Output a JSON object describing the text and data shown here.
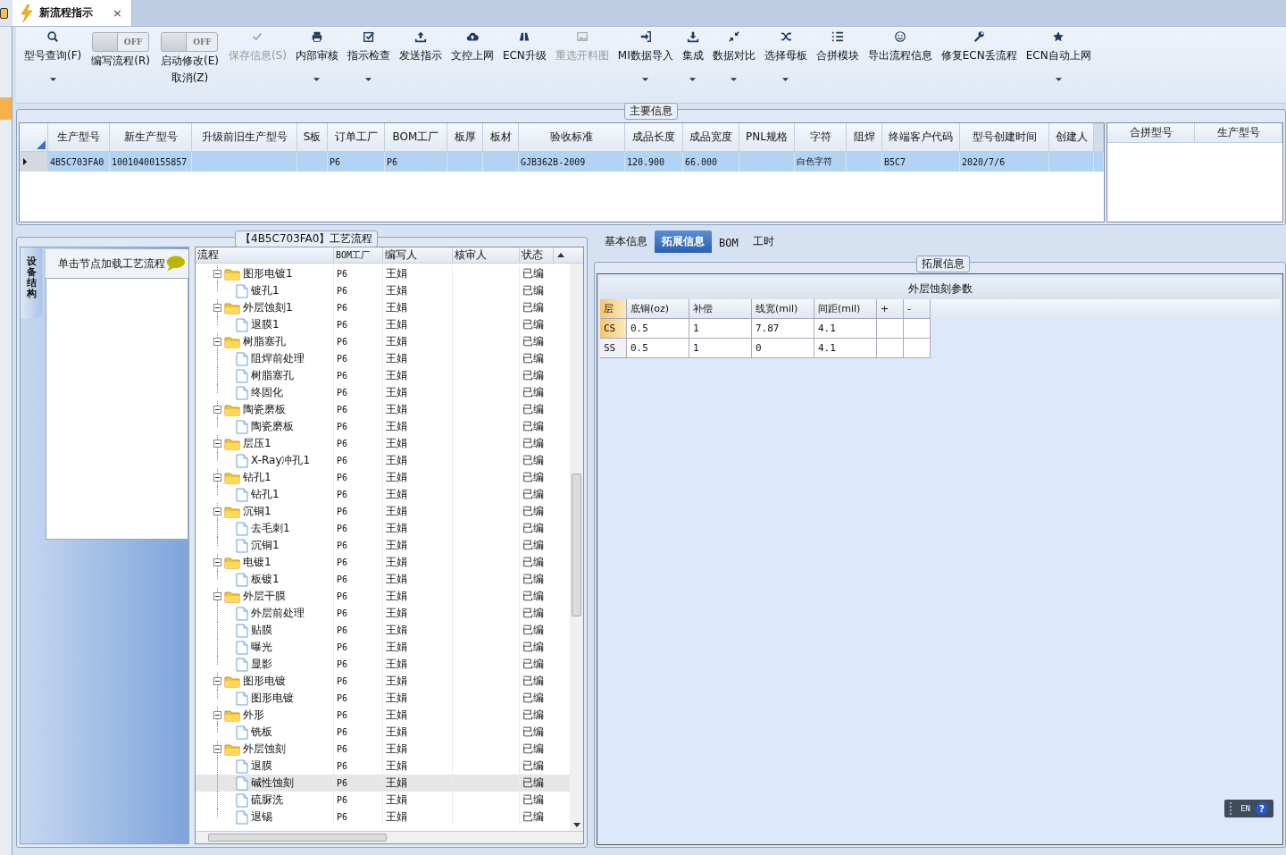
{
  "doc_tab": {
    "title": "新流程指示",
    "close": "×"
  },
  "toolbar": [
    {
      "kind": "button",
      "label": "型号查询(F)",
      "has_menu": true,
      "disabled": false
    },
    {
      "kind": "toggle",
      "toggle_text": "OFF",
      "on": false,
      "label": "编写流程(R)"
    },
    {
      "kind": "toggle",
      "toggle_text": "OFF",
      "on": false,
      "label": "启动修改(E)",
      "sub_label": "取消(Z)"
    },
    {
      "kind": "button",
      "label": "保存信息(S)",
      "has_menu": false,
      "disabled": true
    },
    {
      "kind": "button",
      "label": "内部审核",
      "has_menu": true,
      "disabled": false
    },
    {
      "kind": "button",
      "label": "指示检查",
      "has_menu": true,
      "disabled": false
    },
    {
      "kind": "button",
      "label": "发送指示",
      "has_menu": false,
      "disabled": false
    },
    {
      "kind": "button",
      "label": "文控上网",
      "has_menu": false,
      "disabled": false
    },
    {
      "kind": "button",
      "label": "ECN升级",
      "has_menu": false,
      "disabled": false
    },
    {
      "kind": "button",
      "label": "重选开料图",
      "has_menu": false,
      "disabled": true
    },
    {
      "kind": "button",
      "label": "MI数据导入",
      "has_menu": true,
      "disabled": false
    },
    {
      "kind": "button",
      "label": "集成",
      "has_menu": true,
      "disabled": false
    },
    {
      "kind": "button",
      "label": "数据对比",
      "has_menu": true,
      "disabled": false
    },
    {
      "kind": "button",
      "label": "选择母板",
      "has_menu": true,
      "disabled": false
    },
    {
      "kind": "button",
      "label": "合拼模块",
      "has_menu": false,
      "disabled": false
    },
    {
      "kind": "button",
      "label": "导出流程信息",
      "has_menu": false,
      "disabled": false
    },
    {
      "kind": "button",
      "label": "修复ECN丢流程",
      "has_menu": false,
      "disabled": false
    },
    {
      "kind": "button",
      "label": "ECN自动上网",
      "has_menu": true,
      "disabled": false
    }
  ],
  "main_info": {
    "title": "主要信息",
    "columns": [
      "生产型号",
      "新生产型号",
      "升级前旧生产型号",
      "S板",
      "订单工厂",
      "BOM工厂",
      "板厚",
      "板材",
      "验收标准",
      "成品长度",
      "成品宽度",
      "PNL规格",
      "字符",
      "阻焊",
      "终端客户代码",
      "型号创建时间",
      "创建人"
    ],
    "rows": [
      {
        "selected": true,
        "cells": [
          "4B5C703FA0",
          "10010400155857",
          "",
          "",
          "P6",
          "P6",
          "",
          "",
          "GJB362B-2009",
          "120.900",
          "66.000",
          "",
          "白色字符",
          "",
          "B5C7",
          "2020/7/6",
          ""
        ]
      }
    ],
    "side_columns": [
      "合拼型号",
      "生产型号"
    ]
  },
  "side_panel": {
    "vertical_tab": "设备结构",
    "hint": "单击节点加载工艺流程"
  },
  "process": {
    "title": "【4B5C703FA0】工艺流程",
    "columns": [
      "流程",
      "BOM工厂",
      "编写人",
      "核审人",
      "状态"
    ],
    "tree": [
      {
        "name": "图形电镀1",
        "bom": "P6",
        "writer": "王娟",
        "status": "已编",
        "selected": false,
        "expanded": true,
        "children": [
          {
            "name": "镀孔1",
            "bom": "P6",
            "writer": "王娟",
            "status": "已编",
            "selected": false
          }
        ]
      },
      {
        "name": "外层蚀刻1",
        "bom": "P6",
        "writer": "王娟",
        "status": "已编",
        "selected": false,
        "expanded": true,
        "children": [
          {
            "name": "退膜1",
            "bom": "P6",
            "writer": "王娟",
            "status": "已编",
            "selected": false
          }
        ]
      },
      {
        "name": "树脂塞孔",
        "bom": "P6",
        "writer": "王娟",
        "status": "已编",
        "selected": false,
        "expanded": true,
        "children": [
          {
            "name": "阻焊前处理",
            "bom": "P6",
            "writer": "王娟",
            "status": "已编",
            "selected": false
          },
          {
            "name": "树脂塞孔",
            "bom": "P6",
            "writer": "王娟",
            "status": "已编",
            "selected": false
          },
          {
            "name": "终固化",
            "bom": "P6",
            "writer": "王娟",
            "status": "已编",
            "selected": false
          }
        ]
      },
      {
        "name": "陶瓷磨板",
        "bom": "P6",
        "writer": "王娟",
        "status": "已编",
        "selected": false,
        "expanded": true,
        "children": [
          {
            "name": "陶瓷磨板",
            "bom": "P6",
            "writer": "王娟",
            "status": "已编",
            "selected": false
          }
        ]
      },
      {
        "name": "层压1",
        "bom": "P6",
        "writer": "王娟",
        "status": "已编",
        "selected": false,
        "expanded": true,
        "children": [
          {
            "name": "X-Ray冲孔1",
            "bom": "P6",
            "writer": "王娟",
            "status": "已编",
            "selected": false
          }
        ]
      },
      {
        "name": "钻孔1",
        "bom": "P6",
        "writer": "王娟",
        "status": "已编",
        "selected": false,
        "expanded": true,
        "children": [
          {
            "name": "钻孔1",
            "bom": "P6",
            "writer": "王娟",
            "status": "已编",
            "selected": false
          }
        ]
      },
      {
        "name": "沉铜1",
        "bom": "P6",
        "writer": "王娟",
        "status": "已编",
        "selected": false,
        "expanded": true,
        "children": [
          {
            "name": "去毛刺1",
            "bom": "P6",
            "writer": "王娟",
            "status": "已编",
            "selected": false
          },
          {
            "name": "沉铜1",
            "bom": "P6",
            "writer": "王娟",
            "status": "已编",
            "selected": false
          }
        ]
      },
      {
        "name": "电镀1",
        "bom": "P6",
        "writer": "王娟",
        "status": "已编",
        "selected": false,
        "expanded": true,
        "children": [
          {
            "name": "板镀1",
            "bom": "P6",
            "writer": "王娟",
            "status": "已编",
            "selected": false
          }
        ]
      },
      {
        "name": "外层干膜",
        "bom": "P6",
        "writer": "王娟",
        "status": "已编",
        "selected": false,
        "expanded": true,
        "children": [
          {
            "name": "外层前处理",
            "bom": "P6",
            "writer": "王娟",
            "status": "已编",
            "selected": false
          },
          {
            "name": "贴膜",
            "bom": "P6",
            "writer": "王娟",
            "status": "已编",
            "selected": false
          },
          {
            "name": "曝光",
            "bom": "P6",
            "writer": "王娟",
            "status": "已编",
            "selected": false
          },
          {
            "name": "显影",
            "bom": "P6",
            "writer": "王娟",
            "status": "已编",
            "selected": false
          }
        ]
      },
      {
        "name": "图形电镀",
        "bom": "P6",
        "writer": "王娟",
        "status": "已编",
        "selected": false,
        "expanded": true,
        "children": [
          {
            "name": "图形电镀",
            "bom": "P6",
            "writer": "王娟",
            "status": "已编",
            "selected": false
          }
        ]
      },
      {
        "name": "外形",
        "bom": "P6",
        "writer": "王娟",
        "status": "已编",
        "selected": false,
        "expanded": true,
        "children": [
          {
            "name": "铣板",
            "bom": "P6",
            "writer": "王娟",
            "status": "已编",
            "selected": false
          }
        ]
      },
      {
        "name": "外层蚀刻",
        "bom": "P6",
        "writer": "王娟",
        "status": "已编",
        "selected": false,
        "expanded": true,
        "children": [
          {
            "name": "退膜",
            "bom": "P6",
            "writer": "王娟",
            "status": "已编",
            "selected": false
          },
          {
            "name": "碱性蚀刻",
            "bom": "P6",
            "writer": "王娟",
            "status": "已编",
            "selected": true
          },
          {
            "name": "硫脲洗",
            "bom": "P6",
            "writer": "王娟",
            "status": "已编",
            "selected": false
          },
          {
            "name": "退锡",
            "bom": "P6",
            "writer": "王娟",
            "status": "已编",
            "selected": false
          }
        ]
      }
    ]
  },
  "detail_tabs": [
    {
      "label": "基本信息",
      "selected": false
    },
    {
      "label": "拓展信息",
      "selected": true
    },
    {
      "label": "BOM",
      "selected": false
    },
    {
      "label": "工时",
      "selected": false
    }
  ],
  "extended": {
    "group_title": "拓展信息",
    "table_title": "外层蚀刻参数",
    "columns": [
      "层",
      "底铜(oz)",
      "补偿",
      "线宽(mil)",
      "间距(mil)",
      "+",
      "-"
    ],
    "rows": [
      {
        "selected": true,
        "cells": [
          "CS",
          "0.5",
          "1",
          "7.87",
          "4.1",
          "",
          ""
        ]
      },
      {
        "selected": false,
        "cells": [
          "SS",
          "0.5",
          "1",
          "0",
          "4.1",
          "",
          ""
        ]
      }
    ]
  },
  "language_bar": {
    "language": "EN",
    "help": "?"
  }
}
